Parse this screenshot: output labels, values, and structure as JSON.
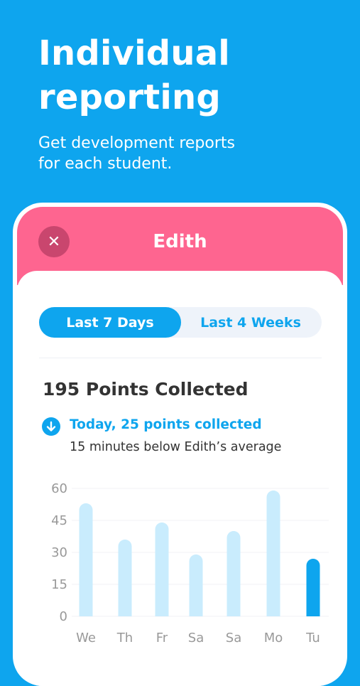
{
  "hero": {
    "title_line1": "Individual",
    "title_line2": "reporting",
    "subtitle": "Get development reports\nfor each student."
  },
  "card": {
    "student_name": "Edith",
    "close_icon": "close-icon",
    "tabs": [
      {
        "label": "Last 7 Days",
        "active": true
      },
      {
        "label": "Last 4 Weeks",
        "active": false
      }
    ],
    "points_title": "195 Points Collected",
    "today_text": "Today, 25 points collected",
    "average_text": "15 minutes below Edith’s average"
  },
  "colors": {
    "background": "#0ea5ee",
    "header": "#fe6590",
    "accent": "#0ea5ee",
    "bar_light": "#c9ecfd",
    "bar_today": "#0ea5ee"
  },
  "chart_data": {
    "type": "bar",
    "categories": [
      "We",
      "Th",
      "Fr",
      "Sa",
      "Sa",
      "Mo",
      "Tu"
    ],
    "values": [
      53,
      36,
      44,
      29,
      40,
      59,
      27
    ],
    "highlight_index": 6,
    "yticks": [
      0,
      15,
      30,
      45,
      60
    ],
    "ylim": [
      0,
      60
    ],
    "title": "",
    "xlabel": "",
    "ylabel": "",
    "grid": true
  }
}
